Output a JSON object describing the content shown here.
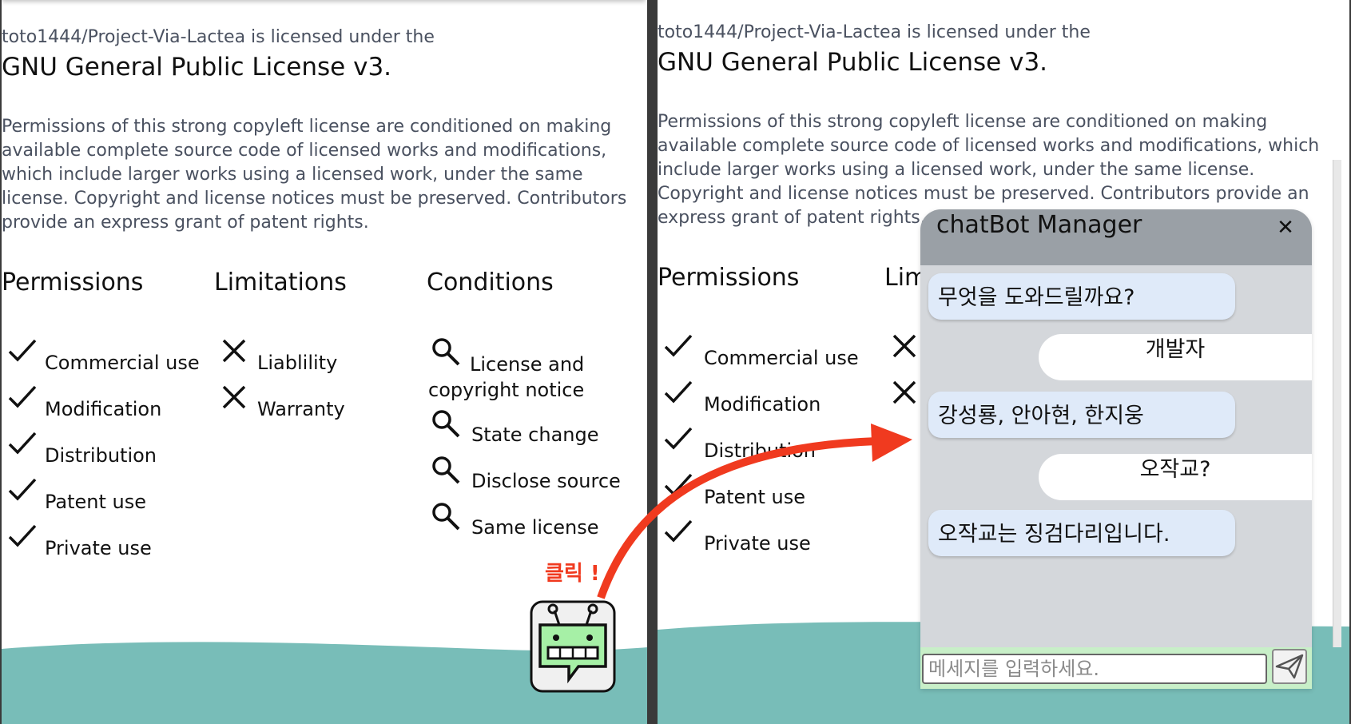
{
  "license": {
    "pre": "toto1444/Project-Via-Lactea is licensed under the",
    "name": "GNU General Public License v3.",
    "description": "Permissions of this strong copyleft license are conditioned on making available complete source code of licensed works and modifications, which include larger works using a licensed work, under the same license. Copyright and license notices must be preserved. Contributors provide an express grant of patent rights."
  },
  "columns": {
    "permissions": {
      "heading": "Permissions",
      "icon": "check-icon",
      "items": [
        "Commercial use",
        "Modification",
        "Distribution",
        "Patent use",
        "Private use"
      ]
    },
    "limitations": {
      "heading": "Limitations",
      "heading_partial": "Lim",
      "icon": "x-icon",
      "items": [
        "Liablility",
        "Warranty"
      ]
    },
    "conditions": {
      "heading": "Conditions",
      "icon": "magnifier-icon",
      "items": [
        "License and copyright notice",
        "State change",
        "Disclose source",
        "Same license"
      ]
    }
  },
  "annotation": {
    "click_label": "클릭 !",
    "arrow_color": "#f03a1f"
  },
  "chatbot": {
    "title": "chatBot Manager",
    "close_icon": "close-icon",
    "messages": [
      {
        "from": "bot",
        "text": "무엇을 도와드릴까요?"
      },
      {
        "from": "user",
        "text": "개발자"
      },
      {
        "from": "bot",
        "text": "강성룡, 안아현, 한지웅"
      },
      {
        "from": "user",
        "text": "오작교?"
      },
      {
        "from": "bot",
        "text": "오작교는 징검다리입니다."
      }
    ],
    "input_placeholder": "메세지를 입력하세요.",
    "input_value": "",
    "send_icon": "paper-plane-icon"
  },
  "colors": {
    "wave": "#78bdb8",
    "bot_bubble": "#dfeaf9",
    "chat_body": "#d4d7db",
    "chat_header": "#9aa0a6",
    "input_bar": "#c8efc8",
    "robot_face": "#a6f0a6"
  }
}
